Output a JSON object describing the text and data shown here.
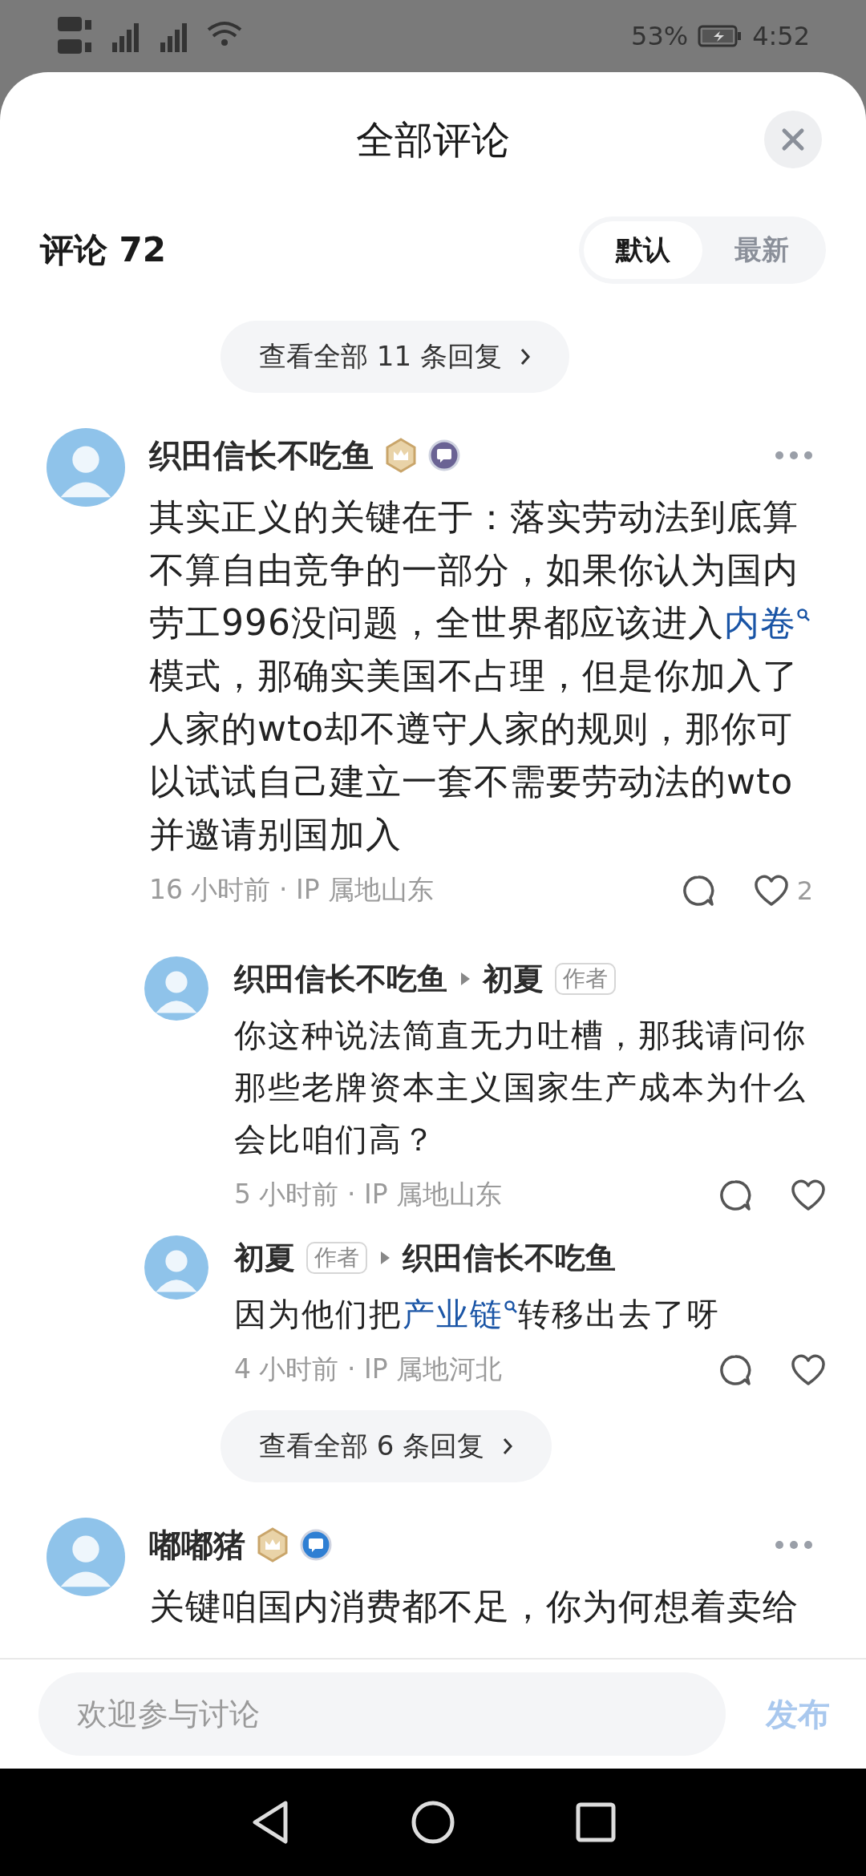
{
  "status_bar": {
    "battery": "53%",
    "time": "4:52"
  },
  "sheet": {
    "title": "全部评论",
    "header": {
      "label": "评论 72",
      "sort_tabs": [
        {
          "label": "默认",
          "selected": true
        },
        {
          "label": "最新",
          "selected": false
        }
      ]
    }
  },
  "comments": [
    {
      "kind": "more",
      "label": "查看全部 11 条回复"
    },
    {
      "kind": "comment",
      "name": "织田信长不吃鱼",
      "badges": [
        {
          "kind": "crown"
        },
        {
          "kind": "chat-purple"
        }
      ],
      "body": [
        {
          "kind": "plain",
          "text": "其实正义的关键在于：落实劳动法到底算不算自由竞争的一部分，如果你认为国内劳工996没问题，全世界都应该进入"
        },
        {
          "kind": "link",
          "text": "内卷"
        },
        {
          "kind": "plain",
          "text": "模式，那确实美国不占理，但是你加入了人家的wto却不遵守人家的规则，那你可以试试自己建立一套不需要劳动法的wto并邀请别国加入"
        }
      ],
      "meta": "16 小时前 · IP 属地山东",
      "likes": "2",
      "replies": [
        {
          "author": {
            "name": "织田信长不吃鱼"
          },
          "target": {
            "name": "初夏",
            "tag": "作者"
          },
          "body": [
            {
              "kind": "plain",
              "text": "你这种说法简直无力吐槽，那我请问你那些老牌资本主义国家生产成本为什么会比咱们高？"
            }
          ],
          "meta": "5 小时前 · IP 属地山东"
        },
        {
          "author": {
            "name": "初夏",
            "tag": "作者"
          },
          "target": {
            "name": "织田信长不吃鱼"
          },
          "body": [
            {
              "kind": "plain",
              "text": "因为他们把"
            },
            {
              "kind": "link",
              "text": "产业链"
            },
            {
              "kind": "plain",
              "text": "转移出去了呀"
            }
          ],
          "meta": "4 小时前 · IP 属地河北"
        }
      ]
    },
    {
      "kind": "more",
      "label": "查看全部 6 条回复"
    },
    {
      "kind": "comment",
      "name": "嘟嘟猪",
      "badges": [
        {
          "kind": "crown"
        },
        {
          "kind": "chat-blue"
        }
      ],
      "body": [
        {
          "kind": "plain",
          "text": "关键咱国内消费都不足，你为何想着卖给"
        }
      ]
    }
  ],
  "composer": {
    "placeholder": "欢迎参与讨论",
    "send": "发布",
    "send_disabled": true
  }
}
